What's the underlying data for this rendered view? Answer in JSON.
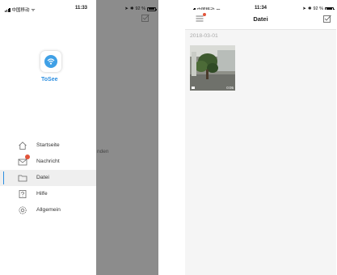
{
  "left_phone": {
    "status": {
      "carrier": "中国移动",
      "time": "11:33",
      "battery": "92 %"
    },
    "app_name": "ToSee",
    "menu": [
      {
        "label": "Startseite",
        "icon": "home-icon"
      },
      {
        "label": "Nachricht",
        "icon": "mail-icon",
        "has_badge": true
      },
      {
        "label": "Datei",
        "icon": "folder-icon",
        "active": true
      },
      {
        "label": "Hilfe",
        "icon": "help-book-icon"
      },
      {
        "label": "Allgemein",
        "icon": "gear-icon"
      }
    ],
    "background_text": "nden"
  },
  "right_phone": {
    "status": {
      "carrier": "中国移动",
      "time": "11:34",
      "battery": "92 %"
    },
    "title": "Datei",
    "date_header": "2018-03-01",
    "thumbnail": {
      "duration": "0:05"
    }
  },
  "colors": {
    "accent": "#2c8ee0",
    "badge": "#e2553b",
    "overlay": "#8c8c8c"
  }
}
